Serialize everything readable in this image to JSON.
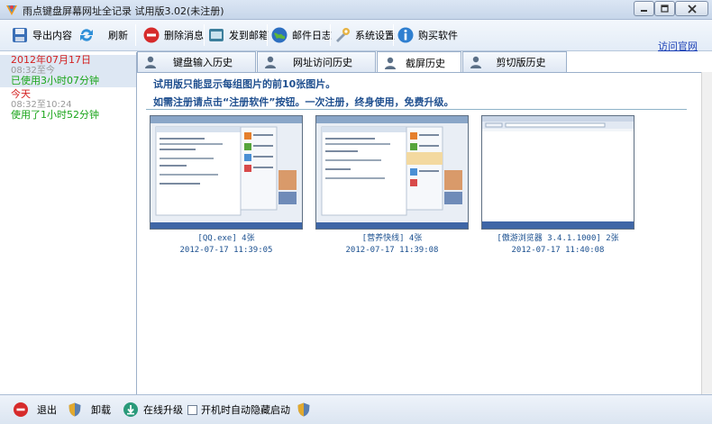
{
  "window": {
    "title": "雨点键盘屏幕网址全记录 试用版3.02(未注册)"
  },
  "toolbar": {
    "export_label": "导出内容",
    "refresh_label": "刷新",
    "delete_label": "删除消息",
    "send_mail_label": "发到邮箱",
    "mail_log_label": "邮件日志",
    "settings_label": "系统设置",
    "buy_label": "购买软件",
    "visit_link": "访问官网"
  },
  "days": [
    {
      "date": "2012年07月17日",
      "range": "08:32至今",
      "usage": "已使用3小时07分钟"
    },
    {
      "date": "今天",
      "range": "08:32至10:24",
      "usage": "使用了1小时52分钟"
    }
  ],
  "tabs": [
    "键盘输入历史",
    "网址访问历史",
    "截屏历史",
    "剪切版历史"
  ],
  "content": {
    "notice_line1": "试用版只能显示每组图片的前10张图片。",
    "notice_line2": "如需注册请点击“注册软件”按钮。一次注册，终身使用，免费升级。",
    "screenshots": [
      {
        "name": "[QQ.exe] 4张",
        "time": "2012-07-17 11:39:05"
      },
      {
        "name": "[营养快线] 4张",
        "time": "2012-07-17 11:39:08"
      },
      {
        "name": "[傲游浏览器 3.4.1.1000] 2张",
        "time": "2012-07-17 11:40:08"
      }
    ]
  },
  "bottom": {
    "exit_label": "退出",
    "uninstall_label": "卸载",
    "upgrade_label": "在线升级",
    "autostart_label": "开机时自动隐藏启动"
  },
  "colors": {
    "accent_blue": "#1f4f8f",
    "date_red": "#d42020",
    "usage_green": "#1aa51a",
    "selected_bg": "#dde7f3"
  }
}
